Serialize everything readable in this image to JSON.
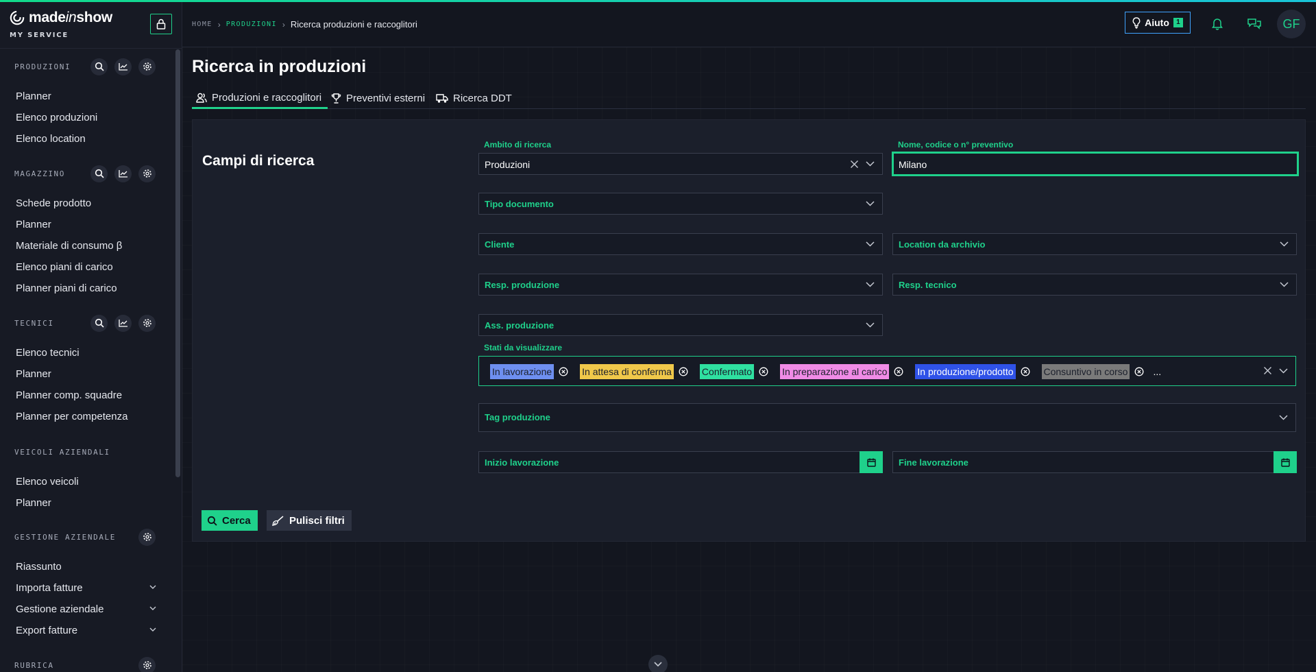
{
  "brand": {
    "name_main": "made",
    "name_italic": "in",
    "name_end": "show",
    "subtitle": "MY SERVICE"
  },
  "colors": {
    "accent": "#1fd18b",
    "help_border": "#3fa3ff"
  },
  "sidebar": {
    "produzioni": {
      "title": "PRODUZIONI",
      "items": [
        "Planner",
        "Elenco produzioni",
        "Elenco location"
      ]
    },
    "magazzino": {
      "title": "MAGAZZINO",
      "items": [
        "Schede prodotto",
        "Planner",
        "Materiale di consumo β",
        "Elenco piani di carico",
        "Planner piani di carico"
      ]
    },
    "tecnici": {
      "title": "TECNICI",
      "items": [
        "Elenco tecnici",
        "Planner",
        "Planner comp. squadre",
        "Planner per competenza"
      ]
    },
    "veicoli": {
      "title": "VEICOLI AZIENDALI",
      "items": [
        "Elenco veicoli",
        "Planner"
      ]
    },
    "gestione": {
      "title": "GESTIONE AZIENDALE",
      "items": [
        "Riassunto",
        "Importa fatture",
        "Gestione aziendale",
        "Export fatture"
      ]
    },
    "rubrica": {
      "title": "RUBRICA"
    }
  },
  "topbar": {
    "breadcrumb": {
      "home": "HOME",
      "section": "PRODUZIONI",
      "current": "Ricerca produzioni e raccoglitori"
    },
    "help_label": "Aiuto",
    "help_count": "1",
    "avatar_initials": "GF"
  },
  "page": {
    "title": "Ricerca in produzioni",
    "tabs": [
      {
        "label": "Produzioni e raccoglitori",
        "icon": "people-icon"
      },
      {
        "label": "Preventivi esterni",
        "icon": "trophy-icon"
      },
      {
        "label": "Ricerca DDT",
        "icon": "truck-icon"
      }
    ]
  },
  "form": {
    "title": "Campi di ricerca",
    "ambito_label": "Ambito di ricerca",
    "ambito_value": "Produzioni",
    "nome_label": "Nome, codice o n° preventivo",
    "nome_value": "Milano",
    "tipo_documento": "Tipo documento",
    "cliente": "Cliente",
    "location": "Location da archivio",
    "resp_produzione": "Resp. produzione",
    "resp_tecnico": "Resp. tecnico",
    "ass_produzione": "Ass. produzione",
    "stati_label": "Stati da visualizzare",
    "stati": [
      {
        "label": "In lavorazione",
        "color": "#6e8ff0"
      },
      {
        "label": "In attesa di conferma",
        "color": "#f0c84a"
      },
      {
        "label": "Confermato",
        "color": "#2fe0a0"
      },
      {
        "label": "In preparazione al carico",
        "color": "#f08be6"
      },
      {
        "label": "In produzione/prodotto",
        "color": "#2f52e8"
      },
      {
        "label": "Consuntivo in corso",
        "color": "#7a7a7a"
      }
    ],
    "stati_more": "...",
    "tag_produzione": "Tag produzione",
    "inizio": "Inizio lavorazione",
    "fine": "Fine lavorazione",
    "search_btn": "Cerca",
    "clear_btn": "Pulisci filtri"
  }
}
